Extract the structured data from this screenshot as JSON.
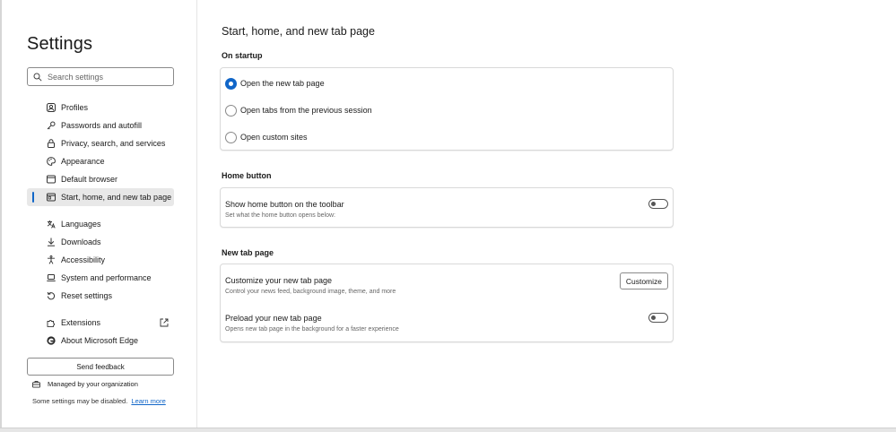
{
  "sidebar": {
    "title": "Settings",
    "search_placeholder": "Search settings",
    "items": [
      {
        "label": "Profiles",
        "icon": "profile-icon"
      },
      {
        "label": "Passwords and autofill",
        "icon": "key-icon"
      },
      {
        "label": "Privacy, search, and services",
        "icon": "lock-icon"
      },
      {
        "label": "Appearance",
        "icon": "palette-icon"
      },
      {
        "label": "Default browser",
        "icon": "browser-icon"
      },
      {
        "label": "Start, home, and new tab page",
        "icon": "start-page-icon",
        "active": true
      },
      {
        "label": "Languages",
        "icon": "language-icon"
      },
      {
        "label": "Downloads",
        "icon": "download-icon"
      },
      {
        "label": "Accessibility",
        "icon": "accessibility-icon"
      },
      {
        "label": "System and performance",
        "icon": "laptop-icon"
      },
      {
        "label": "Reset settings",
        "icon": "reset-icon"
      },
      {
        "label": "Extensions",
        "icon": "extensions-icon"
      },
      {
        "label": "About Microsoft Edge",
        "icon": "edge-logo-icon"
      }
    ],
    "feedback_label": "Send feedback",
    "managed_label": "Managed by your organization",
    "disabled_note": "Some settings may be disabled.",
    "learn_more": "Learn more"
  },
  "main": {
    "page_title": "Start, home, and new tab page",
    "on_startup": {
      "title": "On startup",
      "options": [
        {
          "label": "Open the new tab page",
          "checked": true
        },
        {
          "label": "Open tabs from the previous session",
          "checked": false
        },
        {
          "label": "Open custom sites",
          "checked": false
        }
      ]
    },
    "home_button": {
      "title": "Home button",
      "setting_title": "Show home button on the toolbar",
      "setting_desc": "Set what the home button opens below:",
      "toggle_on": false
    },
    "new_tab_page": {
      "title": "New tab page",
      "customize_title": "Customize your new tab page",
      "customize_desc": "Control your news feed, background image, theme, and more",
      "customize_button": "Customize",
      "preload_title": "Preload your new tab page",
      "preload_desc": "Opens new tab page in the background for a faster experience",
      "preload_on": false
    }
  },
  "colors": {
    "accent": "#1166c8",
    "active_item_bg": "#e8e8e8"
  }
}
